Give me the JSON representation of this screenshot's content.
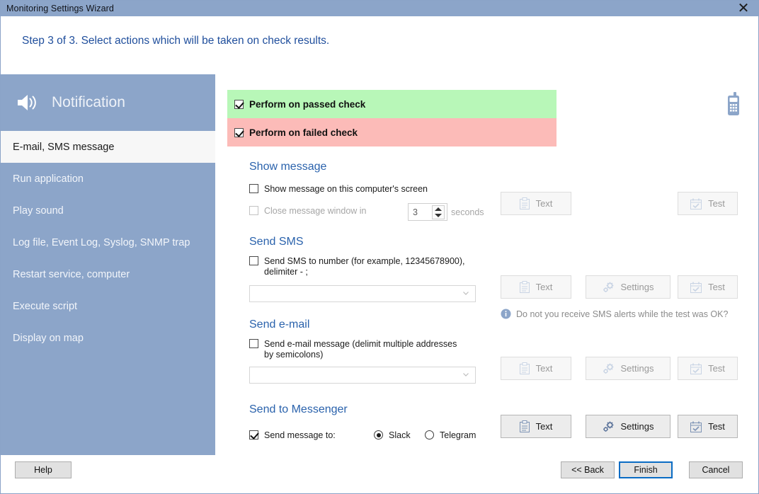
{
  "window": {
    "title": "Monitoring Settings Wizard",
    "close_icon": "close-icon",
    "close_glyph": "✕"
  },
  "header": {
    "step_text": "Step 3 of 3. Select actions which will be taken on check results."
  },
  "sidebar": {
    "icon": "speaker-icon",
    "title": "Notification",
    "items": [
      {
        "label": "E-mail, SMS message",
        "selected": true
      },
      {
        "label": "Run application",
        "selected": false
      },
      {
        "label": "Play sound",
        "selected": false
      },
      {
        "label": "Log file, Event Log, Syslog, SNMP trap",
        "selected": false
      },
      {
        "label": "Restart service, computer",
        "selected": false
      },
      {
        "label": "Execute script",
        "selected": false
      },
      {
        "label": "Display on map",
        "selected": false
      }
    ]
  },
  "main": {
    "decoration_icon": "mobile-phone-icon",
    "banners": [
      {
        "label": "Perform on passed check",
        "checked": true,
        "color": "#b8f7b8"
      },
      {
        "label": "Perform on failed check",
        "checked": true,
        "color": "#fcbbb8"
      }
    ],
    "show_message": {
      "title": "Show message",
      "enable_label": "Show message on this computer's screen",
      "enable_checked": false,
      "close_label": "Close message window in",
      "close_checked": false,
      "close_disabled": true,
      "seconds_value": "3",
      "seconds_unit": "seconds",
      "text_button": "Text",
      "test_button": "Test"
    },
    "send_sms": {
      "title": "Send SMS",
      "enable_label": "Send SMS to number (for example, 12345678900), delimiter - ;",
      "enable_checked": false,
      "combo_value": "",
      "text_button": "Text",
      "settings_button": "Settings",
      "test_button": "Test",
      "hint": "Do not you receive SMS alerts while the test was OK?",
      "hint_icon": "info-icon"
    },
    "send_email": {
      "title": "Send e-mail",
      "enable_label": "Send e-mail message (delimit multiple addresses by semicolons)",
      "enable_checked": false,
      "combo_value": "",
      "text_button": "Text",
      "settings_button": "Settings",
      "test_button": "Test"
    },
    "send_messenger": {
      "title": "Send to Messenger",
      "enable_label": "Send message to:",
      "enable_checked": true,
      "options": [
        {
          "label": "Slack",
          "selected": true
        },
        {
          "label": "Telegram",
          "selected": false
        }
      ],
      "text_button": "Text",
      "settings_button": "Settings",
      "test_button": "Test"
    }
  },
  "footer": {
    "help": "Help",
    "back": "<< Back",
    "finish": "Finish",
    "cancel": "Cancel"
  },
  "colors": {
    "accent": "#8ca5c9",
    "link": "#2a62ac",
    "pass": "#b8f7b8",
    "fail": "#fcbbb8",
    "primary_border": "#0a6cc4"
  }
}
